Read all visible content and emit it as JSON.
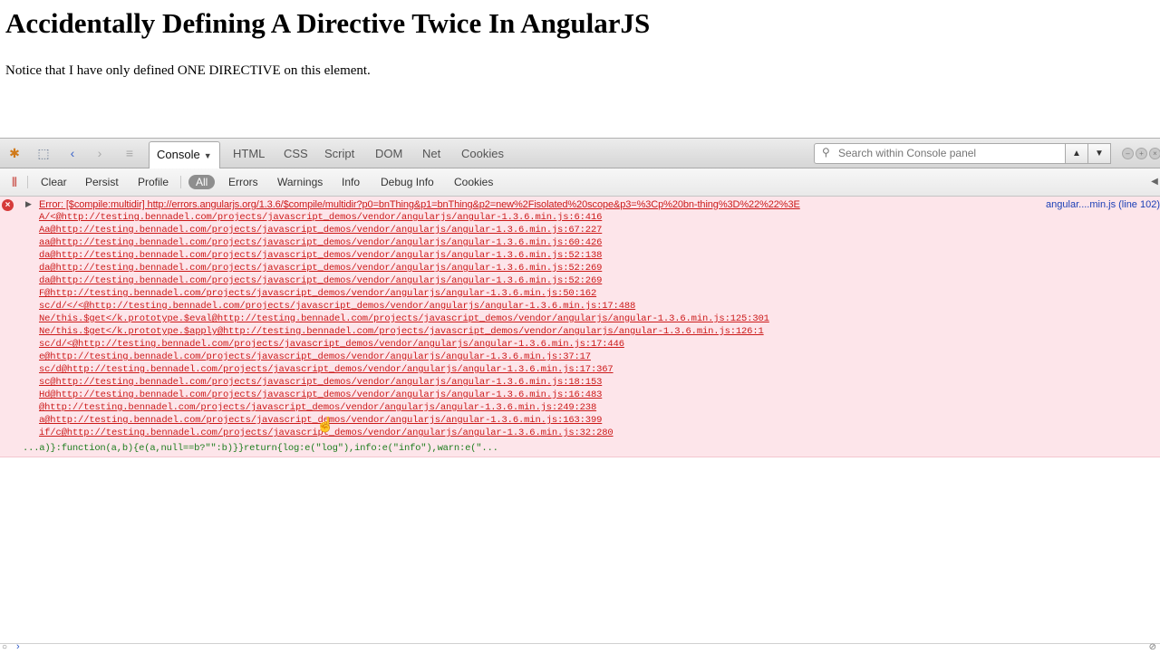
{
  "page": {
    "title": "Accidentally Defining A Directive Twice In AngularJS",
    "text": "Notice that I have only defined ONE DIRECTIVE on this element."
  },
  "firebug": {
    "tabs": [
      "Console",
      "HTML",
      "CSS",
      "Script",
      "DOM",
      "Net",
      "Cookies"
    ],
    "active_tab": "Console",
    "search_placeholder": "Search within Console panel",
    "console_toolbar": {
      "clear": "Clear",
      "persist": "Persist",
      "profile": "Profile",
      "filters": [
        "All",
        "Errors",
        "Warnings",
        "Info",
        "Debug Info",
        "Cookies"
      ]
    },
    "error": {
      "message": "Error: [$compile:multidir] http://errors.angularjs.org/1.3.6/$compile/multidir?p0=bnThing&p1=bnThing&p2=new%2Fisolated%20scope&p3=%3Cp%20bn-thing%3D%22%22%3E",
      "source": "angular....min.js (line 102)",
      "stack": [
        "A/<@http://testing.bennadel.com/projects/javascript_demos/vendor/angularjs/angular-1.3.6.min.js:6:416",
        "Aa@http://testing.bennadel.com/projects/javascript_demos/vendor/angularjs/angular-1.3.6.min.js:67:227",
        "aa@http://testing.bennadel.com/projects/javascript_demos/vendor/angularjs/angular-1.3.6.min.js:60:426",
        "da@http://testing.bennadel.com/projects/javascript_demos/vendor/angularjs/angular-1.3.6.min.js:52:138",
        "da@http://testing.bennadel.com/projects/javascript_demos/vendor/angularjs/angular-1.3.6.min.js:52:269",
        "da@http://testing.bennadel.com/projects/javascript_demos/vendor/angularjs/angular-1.3.6.min.js:52:269",
        "F@http://testing.bennadel.com/projects/javascript_demos/vendor/angularjs/angular-1.3.6.min.js:50:162",
        "sc/d/</<@http://testing.bennadel.com/projects/javascript_demos/vendor/angularjs/angular-1.3.6.min.js:17:488",
        "Ne/this.$get</k.prototype.$eval@http://testing.bennadel.com/projects/javascript_demos/vendor/angularjs/angular-1.3.6.min.js:125:301",
        "Ne/this.$get</k.prototype.$apply@http://testing.bennadel.com/projects/javascript_demos/vendor/angularjs/angular-1.3.6.min.js:126:1",
        "sc/d/<@http://testing.bennadel.com/projects/javascript_demos/vendor/angularjs/angular-1.3.6.min.js:17:446",
        "e@http://testing.bennadel.com/projects/javascript_demos/vendor/angularjs/angular-1.3.6.min.js:37:17",
        "sc/d@http://testing.bennadel.com/projects/javascript_demos/vendor/angularjs/angular-1.3.6.min.js:17:367",
        "sc@http://testing.bennadel.com/projects/javascript_demos/vendor/angularjs/angular-1.3.6.min.js:18:153",
        "Hd@http://testing.bennadel.com/projects/javascript_demos/vendor/angularjs/angular-1.3.6.min.js:16:483",
        "@http://testing.bennadel.com/projects/javascript_demos/vendor/angularjs/angular-1.3.6.min.js:249:238",
        "a@http://testing.bennadel.com/projects/javascript_demos/vendor/angularjs/angular-1.3.6.min.js:163:399",
        "if/c@http://testing.bennadel.com/projects/javascript_demos/vendor/angularjs/angular-1.3.6.min.js:32:280"
      ],
      "code_snippet": "...a)}:function(a,b){e(a,null==b?\"\":b)}}return{log:e(\"log\"),info:e(\"info\"),warn:e(\"..."
    },
    "icons": {
      "firebug": "firebug-icon",
      "inspect": "inspect-icon",
      "back": "back-arrow-icon",
      "forward": "forward-arrow-icon",
      "expand": "command-line-icon"
    }
  }
}
